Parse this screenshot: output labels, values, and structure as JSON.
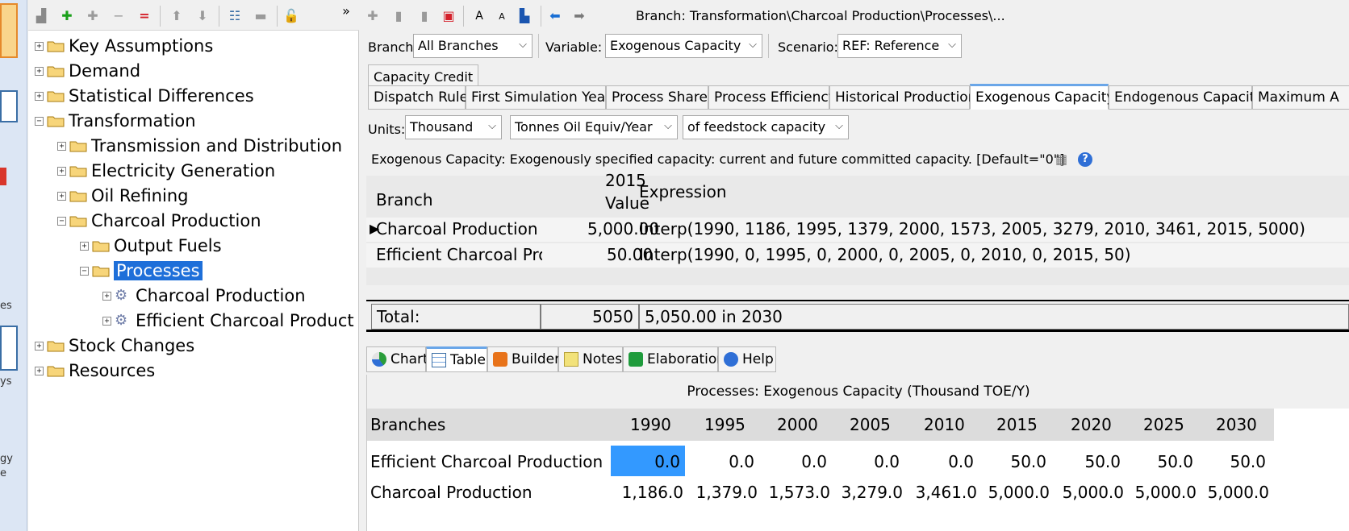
{
  "left_strip": {
    "labels": [
      "es",
      "ys",
      "gy",
      "e"
    ]
  },
  "tree": {
    "items": [
      {
        "label": "Key Assumptions"
      },
      {
        "label": "Demand"
      },
      {
        "label": "Statistical Differences"
      },
      {
        "label": "Transformation"
      },
      {
        "label": "Transmission and Distribution"
      },
      {
        "label": "Electricity Generation"
      },
      {
        "label": "Oil Refining"
      },
      {
        "label": "Charcoal Production"
      },
      {
        "label": "Output Fuels"
      },
      {
        "label": "Processes"
      },
      {
        "label": "Charcoal Production"
      },
      {
        "label": "Efficient Charcoal Product"
      },
      {
        "label": "Stock Changes"
      },
      {
        "label": "Resources"
      }
    ],
    "toolbar_more": "»"
  },
  "main": {
    "branch_path": "Branch: Transformation\\Charcoal Production\\Processes\\...",
    "branch_label": "Branch:",
    "branch_value": "All Branches",
    "variable_label": "Variable:",
    "variable_value": "Exogenous Capacity",
    "scenario_label": "Scenario:",
    "scenario_value": "REF: Reference",
    "tabs_row1": [
      "Capacity Credit"
    ],
    "tabs_row2": [
      "Dispatch Rule",
      "First Simulation Year",
      "Process Share",
      "Process Efficiency",
      "Historical Production",
      "Exogenous Capacity",
      "Endogenous Capacity",
      "Maximum A"
    ],
    "units_label": "Units:",
    "units_value": "Thousand",
    "units_measure": "Tonnes Oil Equiv/Year",
    "units_qualifier": "of feedstock capacity",
    "description": "Exogenous Capacity: Exogenously specified capacity: current and future committed capacity. [Default=\"0\"]",
    "grid": {
      "col_branch": "Branch",
      "col_year": "2015",
      "col_value": "Value",
      "col_expression": "Expression",
      "rows": [
        {
          "branch": "Charcoal Production",
          "value": "5,000.00",
          "expression": "Interp(1990, 1186, 1995, 1379, 2000, 1573, 2005, 3279, 2010, 3461, 2015, 5000)"
        },
        {
          "branch": "Efficient Charcoal Proc",
          "value": "50.00",
          "expression": "Interp(1990, 0, 1995, 0, 2000, 0, 2005, 0, 2010, 0, 2015, 50)"
        }
      ],
      "total_label": "Total:",
      "total_value": "5050",
      "total_expression": "5,050.00 in 2030"
    },
    "bottom_tabs": [
      "Chart",
      "Table",
      "Builder",
      "Notes",
      "Elaboration",
      "Help"
    ],
    "table": {
      "title": "Processes: Exogenous Capacity (Thousand TOE/Y)",
      "header_branches": "Branches",
      "years": [
        "1990",
        "1995",
        "2000",
        "2005",
        "2010",
        "2015",
        "2020",
        "2025",
        "2030"
      ],
      "rows": [
        {
          "name": "Efficient Charcoal Production",
          "values": [
            "0.0",
            "0.0",
            "0.0",
            "0.0",
            "0.0",
            "50.0",
            "50.0",
            "50.0",
            "50.0"
          ]
        },
        {
          "name": "Charcoal Production",
          "values": [
            "1,186.0",
            "1,379.0",
            "1,573.0",
            "3,279.0",
            "3,461.0",
            "5,000.0",
            "5,000.0",
            "5,000.0",
            "5,000.0"
          ]
        }
      ]
    }
  }
}
